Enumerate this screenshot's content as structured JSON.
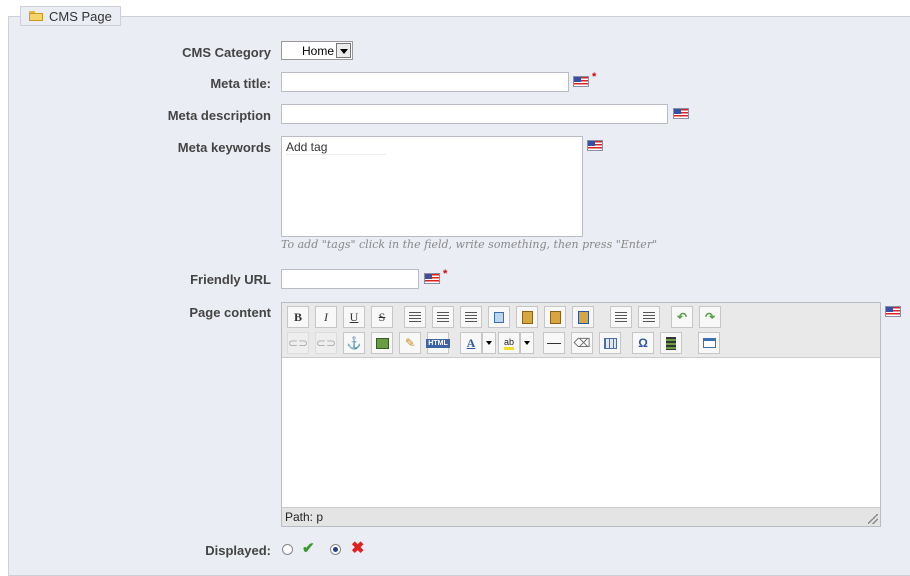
{
  "fieldset": {
    "title": "CMS Page"
  },
  "form": {
    "cms_category": {
      "label": "CMS Category",
      "value": "Home"
    },
    "meta_title": {
      "label": "Meta title:",
      "value": "",
      "required": "*"
    },
    "meta_description": {
      "label": "Meta description",
      "value": ""
    },
    "meta_keywords": {
      "label": "Meta keywords",
      "placeholder": "Add tag",
      "hint": "To add \"tags\" click in the field, write something, then press \"Enter\""
    },
    "friendly_url": {
      "label": "Friendly URL",
      "value": "",
      "required": "*"
    },
    "page_content": {
      "label": "Page content",
      "path": "Path: p"
    },
    "displayed": {
      "label": "Displayed:",
      "selected": "no"
    }
  },
  "toolbar": {
    "bold": "B",
    "italic": "I",
    "underline": "U",
    "strike": "S",
    "link_icon": "link-icon",
    "html_label": "HTML",
    "omega": "Ω"
  },
  "colors": {
    "panel_bg": "#ebedf4",
    "required": "#dd0000",
    "yes_green": "#3a9a2a",
    "no_red": "#e02020"
  }
}
